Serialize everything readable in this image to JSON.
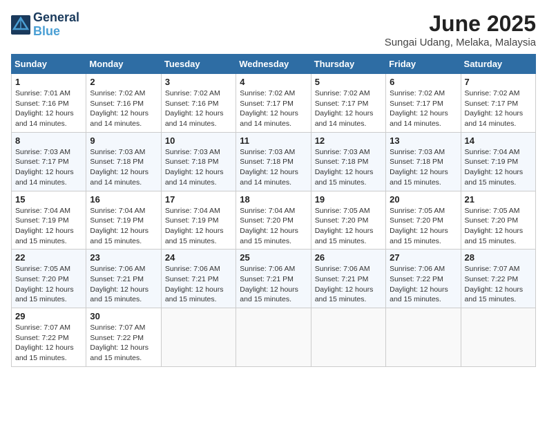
{
  "logo": {
    "line1": "General",
    "line2": "Blue"
  },
  "title": "June 2025",
  "location": "Sungai Udang, Melaka, Malaysia",
  "weekdays": [
    "Sunday",
    "Monday",
    "Tuesday",
    "Wednesday",
    "Thursday",
    "Friday",
    "Saturday"
  ],
  "weeks": [
    [
      {
        "day": "1",
        "info": "Sunrise: 7:01 AM\nSunset: 7:16 PM\nDaylight: 12 hours\nand 14 minutes."
      },
      {
        "day": "2",
        "info": "Sunrise: 7:02 AM\nSunset: 7:16 PM\nDaylight: 12 hours\nand 14 minutes."
      },
      {
        "day": "3",
        "info": "Sunrise: 7:02 AM\nSunset: 7:16 PM\nDaylight: 12 hours\nand 14 minutes."
      },
      {
        "day": "4",
        "info": "Sunrise: 7:02 AM\nSunset: 7:17 PM\nDaylight: 12 hours\nand 14 minutes."
      },
      {
        "day": "5",
        "info": "Sunrise: 7:02 AM\nSunset: 7:17 PM\nDaylight: 12 hours\nand 14 minutes."
      },
      {
        "day": "6",
        "info": "Sunrise: 7:02 AM\nSunset: 7:17 PM\nDaylight: 12 hours\nand 14 minutes."
      },
      {
        "day": "7",
        "info": "Sunrise: 7:02 AM\nSunset: 7:17 PM\nDaylight: 12 hours\nand 14 minutes."
      }
    ],
    [
      {
        "day": "8",
        "info": "Sunrise: 7:03 AM\nSunset: 7:17 PM\nDaylight: 12 hours\nand 14 minutes."
      },
      {
        "day": "9",
        "info": "Sunrise: 7:03 AM\nSunset: 7:18 PM\nDaylight: 12 hours\nand 14 minutes."
      },
      {
        "day": "10",
        "info": "Sunrise: 7:03 AM\nSunset: 7:18 PM\nDaylight: 12 hours\nand 14 minutes."
      },
      {
        "day": "11",
        "info": "Sunrise: 7:03 AM\nSunset: 7:18 PM\nDaylight: 12 hours\nand 14 minutes."
      },
      {
        "day": "12",
        "info": "Sunrise: 7:03 AM\nSunset: 7:18 PM\nDaylight: 12 hours\nand 15 minutes."
      },
      {
        "day": "13",
        "info": "Sunrise: 7:03 AM\nSunset: 7:18 PM\nDaylight: 12 hours\nand 15 minutes."
      },
      {
        "day": "14",
        "info": "Sunrise: 7:04 AM\nSunset: 7:19 PM\nDaylight: 12 hours\nand 15 minutes."
      }
    ],
    [
      {
        "day": "15",
        "info": "Sunrise: 7:04 AM\nSunset: 7:19 PM\nDaylight: 12 hours\nand 15 minutes."
      },
      {
        "day": "16",
        "info": "Sunrise: 7:04 AM\nSunset: 7:19 PM\nDaylight: 12 hours\nand 15 minutes."
      },
      {
        "day": "17",
        "info": "Sunrise: 7:04 AM\nSunset: 7:19 PM\nDaylight: 12 hours\nand 15 minutes."
      },
      {
        "day": "18",
        "info": "Sunrise: 7:04 AM\nSunset: 7:20 PM\nDaylight: 12 hours\nand 15 minutes."
      },
      {
        "day": "19",
        "info": "Sunrise: 7:05 AM\nSunset: 7:20 PM\nDaylight: 12 hours\nand 15 minutes."
      },
      {
        "day": "20",
        "info": "Sunrise: 7:05 AM\nSunset: 7:20 PM\nDaylight: 12 hours\nand 15 minutes."
      },
      {
        "day": "21",
        "info": "Sunrise: 7:05 AM\nSunset: 7:20 PM\nDaylight: 12 hours\nand 15 minutes."
      }
    ],
    [
      {
        "day": "22",
        "info": "Sunrise: 7:05 AM\nSunset: 7:20 PM\nDaylight: 12 hours\nand 15 minutes."
      },
      {
        "day": "23",
        "info": "Sunrise: 7:06 AM\nSunset: 7:21 PM\nDaylight: 12 hours\nand 15 minutes."
      },
      {
        "day": "24",
        "info": "Sunrise: 7:06 AM\nSunset: 7:21 PM\nDaylight: 12 hours\nand 15 minutes."
      },
      {
        "day": "25",
        "info": "Sunrise: 7:06 AM\nSunset: 7:21 PM\nDaylight: 12 hours\nand 15 minutes."
      },
      {
        "day": "26",
        "info": "Sunrise: 7:06 AM\nSunset: 7:21 PM\nDaylight: 12 hours\nand 15 minutes."
      },
      {
        "day": "27",
        "info": "Sunrise: 7:06 AM\nSunset: 7:22 PM\nDaylight: 12 hours\nand 15 minutes."
      },
      {
        "day": "28",
        "info": "Sunrise: 7:07 AM\nSunset: 7:22 PM\nDaylight: 12 hours\nand 15 minutes."
      }
    ],
    [
      {
        "day": "29",
        "info": "Sunrise: 7:07 AM\nSunset: 7:22 PM\nDaylight: 12 hours\nand 15 minutes."
      },
      {
        "day": "30",
        "info": "Sunrise: 7:07 AM\nSunset: 7:22 PM\nDaylight: 12 hours\nand 15 minutes."
      },
      {
        "day": "",
        "info": ""
      },
      {
        "day": "",
        "info": ""
      },
      {
        "day": "",
        "info": ""
      },
      {
        "day": "",
        "info": ""
      },
      {
        "day": "",
        "info": ""
      }
    ]
  ]
}
